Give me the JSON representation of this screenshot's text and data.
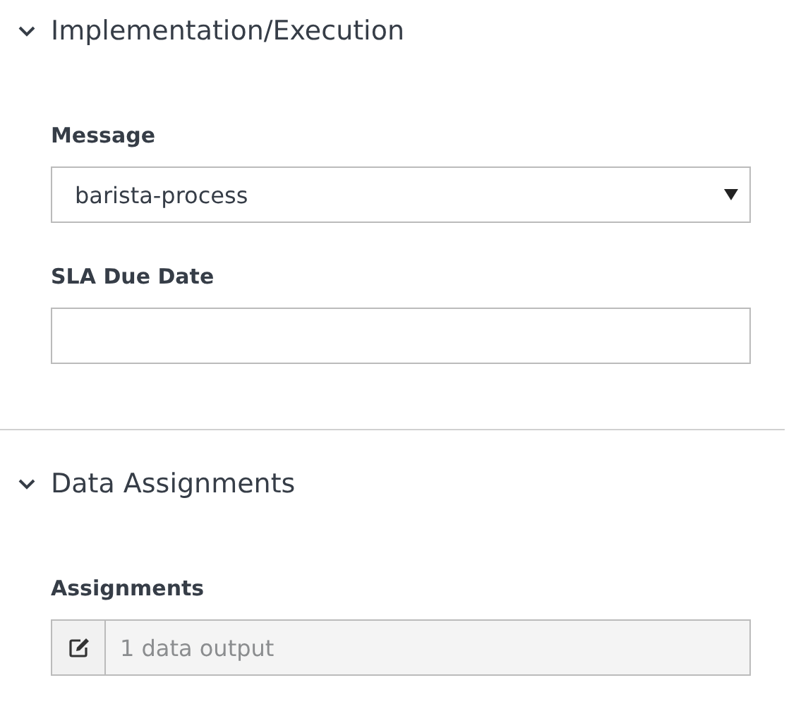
{
  "sections": [
    {
      "title": "Implementation/Execution",
      "expanded": true,
      "fields": [
        {
          "kind": "select",
          "label": "Message",
          "value": "barista-process"
        },
        {
          "kind": "text",
          "label": "SLA Due Date"
        }
      ]
    },
    {
      "title": "Data Assignments",
      "expanded": true,
      "fields": [
        {
          "kind": "assignments",
          "label": "Assignments",
          "value": "1 data output",
          "disabled": true
        }
      ]
    }
  ]
}
